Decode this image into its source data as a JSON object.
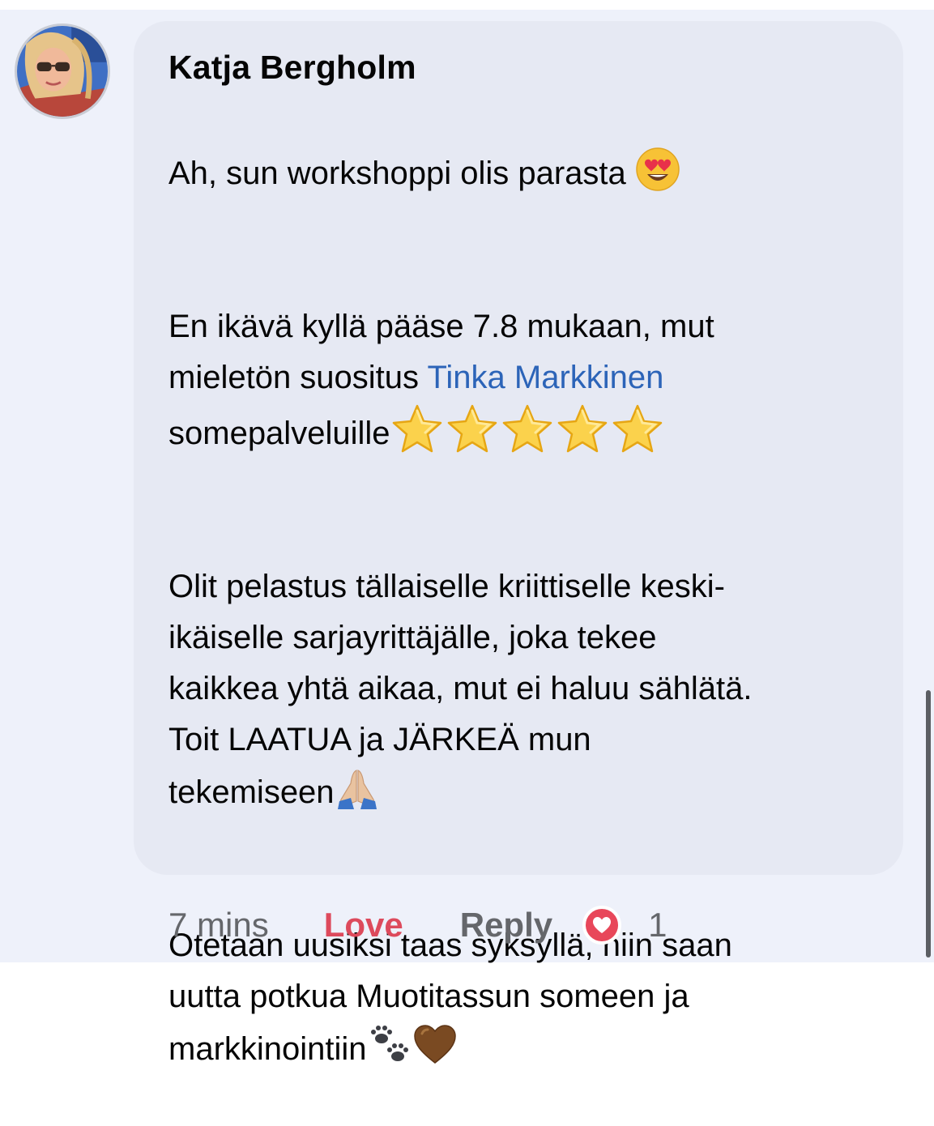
{
  "comment": {
    "author": "Katja Bergholm",
    "paragraphs": [
      [
        "Ah, sun workshoppi olis parasta "
      ],
      [
        "En ikävä kyllä pääse 7.8 mukaan, mut\nmieletön suositus ",
        "Tinka Markkinen",
        "\nsomepalveluille"
      ],
      [
        "Olit pelastus tällaiselle kriittiselle keski-\nikäiselle sarjayrittäjälle, joka tekee\nkaikkea yhtä aikaa, mut ei haluu sählätä.\nToit LAATUA ja JÄRKEÄ mun\ntekemiseen"
      ],
      [
        "Otetaan uusiksi taas syksyllä, niin saan\nuutta potkua Muotitassun someen ja\nmarkkinointiin"
      ]
    ],
    "emojis": [
      "heart-eyes-emoji",
      "star-emoji",
      "folded-hands-emoji",
      "paw-prints-emoji",
      "brown-heart-emoji"
    ]
  },
  "actions": {
    "time": "7 mins",
    "love_label": "Love",
    "reply_label": "Reply",
    "reaction_count": "1"
  },
  "colors": {
    "background": "#eef1fa",
    "bubble": "#e6e9f3",
    "mention": "#2c64b8",
    "love": "#dd4a5c",
    "meta": "#65676b"
  }
}
